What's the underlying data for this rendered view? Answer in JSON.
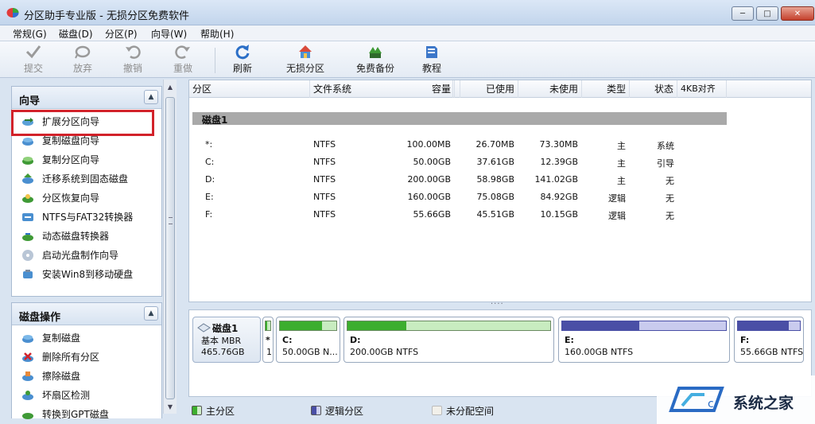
{
  "window": {
    "title": "分区助手专业版 - 无损分区免费软件"
  },
  "menu": [
    "常规(G)",
    "磁盘(D)",
    "分区(P)",
    "向导(W)",
    "帮助(H)"
  ],
  "toolbar": {
    "commit": "提交",
    "discard": "放弃",
    "undo": "撤销",
    "redo": "重做",
    "refresh": "刷新",
    "lossless": "无损分区",
    "backup": "免费备份",
    "tutorial": "教程"
  },
  "wizard_panel": {
    "title": "向导",
    "items": [
      "扩展分区向导",
      "复制磁盘向导",
      "复制分区向导",
      "迁移系统到固态磁盘",
      "分区恢复向导",
      "NTFS与FAT32转换器",
      "动态磁盘转换器",
      "启动光盘制作向导",
      "安装Win8到移动硬盘"
    ]
  },
  "disk_panel": {
    "title": "磁盘操作",
    "items": [
      "复制磁盘",
      "删除所有分区",
      "擦除磁盘",
      "坏扇区检测",
      "转换到GPT磁盘"
    ]
  },
  "table": {
    "columns": [
      "分区",
      "文件系统",
      "容量",
      "已使用",
      "未使用",
      "类型",
      "状态",
      "4KB对齐"
    ],
    "disk_label": "磁盘1",
    "rows": [
      {
        "part": "*:",
        "fs": "NTFS",
        "cap": "100.00MB",
        "used": "26.70MB",
        "free": "73.30MB",
        "type": "主",
        "status": "系统"
      },
      {
        "part": "C:",
        "fs": "NTFS",
        "cap": "50.00GB",
        "used": "37.61GB",
        "free": "12.39GB",
        "type": "主",
        "status": "引导"
      },
      {
        "part": "D:",
        "fs": "NTFS",
        "cap": "200.00GB",
        "used": "58.98GB",
        "free": "141.02GB",
        "type": "主",
        "status": "无"
      },
      {
        "part": "E:",
        "fs": "NTFS",
        "cap": "160.00GB",
        "used": "75.08GB",
        "free": "84.92GB",
        "type": "逻辑",
        "status": "无"
      },
      {
        "part": "F:",
        "fs": "NTFS",
        "cap": "55.66GB",
        "used": "45.51GB",
        "free": "10.15GB",
        "type": "逻辑",
        "status": "无"
      }
    ]
  },
  "diskmap": {
    "disk": {
      "name": "磁盘1",
      "type": "基本 MBR",
      "size": "465.76GB"
    },
    "sys": {
      "label": "*",
      "num": "1",
      "used_fraction": 0.27
    },
    "c": {
      "label": "C:",
      "desc": "50.00GB N...",
      "used_fraction": 0.75
    },
    "d": {
      "label": "D:",
      "desc": "200.00GB NTFS",
      "used_fraction": 0.29
    },
    "e": {
      "label": "E:",
      "desc": "160.00GB NTFS",
      "used_fraction": 0.47
    },
    "f": {
      "label": "F:",
      "desc": "55.66GB NTFS",
      "used_fraction": 0.82
    }
  },
  "legend": {
    "primary": "主分区",
    "logical": "逻辑分区",
    "unallocated": "未分配空间"
  },
  "watermark": {
    "text": "系统之家"
  },
  "colors": {
    "primary": "#3cae2e",
    "logical": "#4a4fa6",
    "highlight": "#d2222a"
  }
}
